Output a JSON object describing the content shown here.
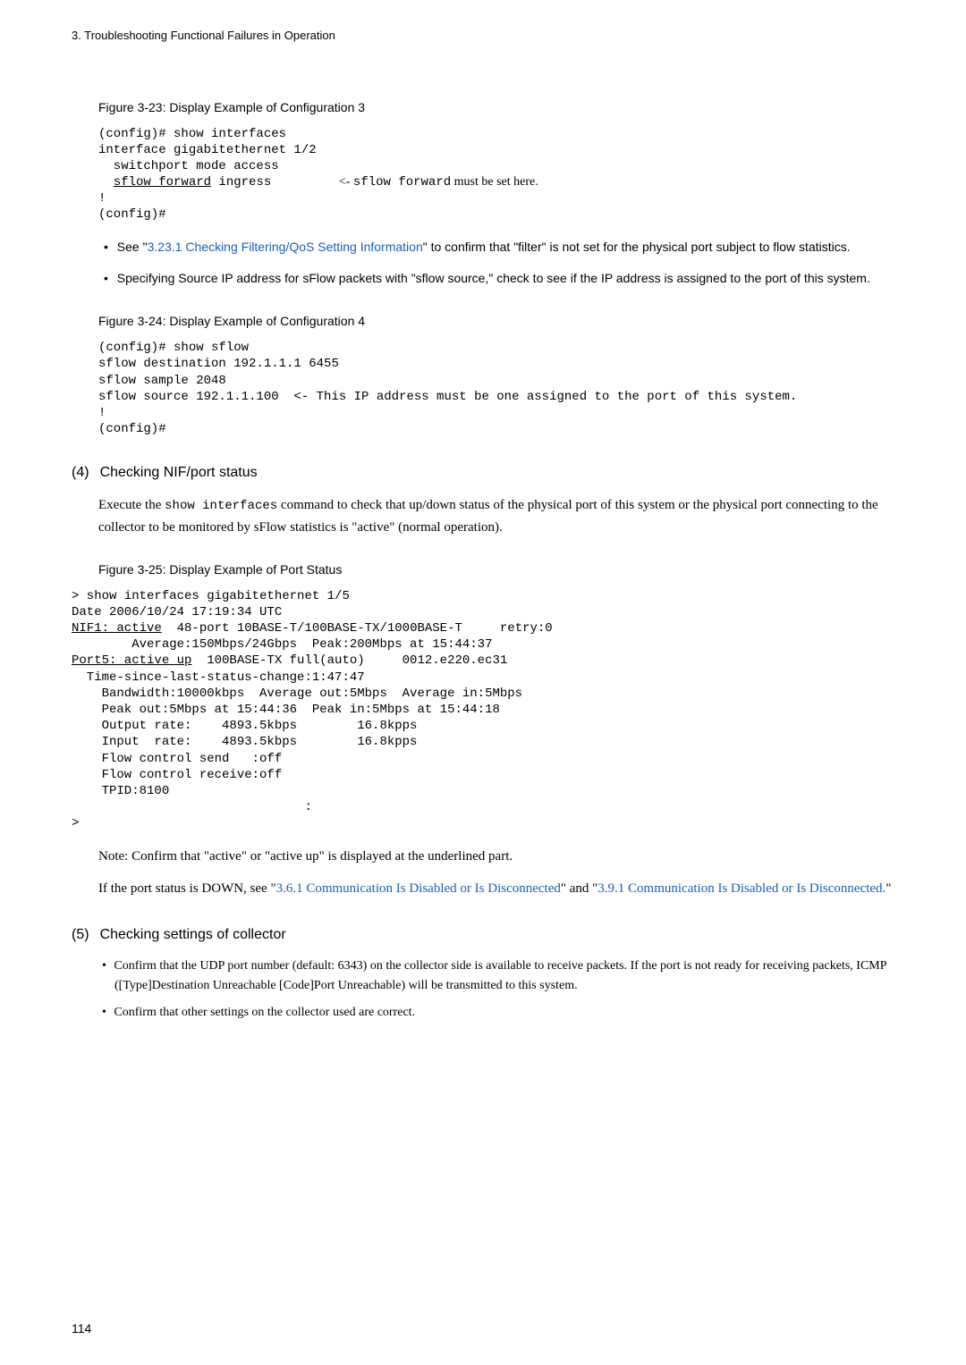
{
  "header": {
    "chapter_number": "3.",
    "chapter_title": "Troubleshooting Functional Failures in Operation"
  },
  "fig323": {
    "title": "Figure 3-23: Display Example of Configuration 3",
    "line1": "(config)# show interfaces",
    "line2": "interface gigabitethernet 1/2",
    "line3": "  switchport mode access",
    "line4a": "  ",
    "line4b": "sflow forward",
    "line4c": " ingress         ",
    "line4d": "<- ",
    "line4e": "sflow forward",
    "line4f": " must be set here.",
    "line5": "!",
    "line6": "(config)#"
  },
  "bullets1": {
    "b1_prefix": "See \"",
    "b1_link": "3.23.1 Checking Filtering/QoS Setting Information",
    "b1_suffix": "\" to confirm that \"filter\" is not set for the physical port subject to flow statistics.",
    "b2": "Specifying Source IP address for sFlow packets with \"sflow source,\" check to see if the IP address is assigned to the port of this system."
  },
  "fig324": {
    "title": "Figure 3-24: Display Example of Configuration 4",
    "line1": "(config)# show sflow",
    "line2": "sflow destination 192.1.1.1 6455",
    "line3": "sflow sample 2048",
    "line4": "sflow source 192.1.1.100  <- This IP address must be one assigned to the port of this system.",
    "line5": "!",
    "line6": "(config)#"
  },
  "section4": {
    "prefix": "(4)",
    "title": "Checking NIF/port status",
    "body_part1": "Execute the ",
    "body_cmd": "show interfaces",
    "body_part2": " command to check that up/down status of the physical port of this system or the physical port connecting to the collector to be monitored by sFlow statistics is \"active\" (normal operation)."
  },
  "fig325": {
    "title": "Figure 3-25: Display Example of Port Status",
    "l1": "> show interfaces gigabitethernet 1/5",
    "l2": "Date 2006/10/24 17:19:34 UTC",
    "l3a": "NIF1: active",
    "l3b": "  48-port 10BASE-T/100BASE-TX/1000BASE-T     retry:0",
    "l4": "        Average:150Mbps/24Gbps  Peak:200Mbps at 15:44:37",
    "l5a": "Port5: active up",
    "l5b": "  100BASE-TX full(auto)     0012.e220.ec31",
    "l6": "  Time-since-last-status-change:1:47:47",
    "l7": "    Bandwidth:10000kbps  Average out:5Mbps  Average in:5Mbps",
    "l8": "    Peak out:5Mbps at 15:44:36  Peak in:5Mbps at 15:44:18",
    "l9": "    Output rate:    4893.5kbps        16.8kpps",
    "l10": "    Input  rate:    4893.5kbps        16.8kpps",
    "l11": "    Flow control send   :off",
    "l12": "    Flow control receive:off",
    "l13": "    TPID:8100",
    "l14": "                               :",
    "l15": ">"
  },
  "note1": "Note: Confirm that \"active\" or \"active up\" is displayed at the underlined part.",
  "note2": {
    "p1": "If the port status is DOWN, see \"",
    "link1": "3.6.1 Communication Is Disabled or Is Disconnected",
    "mid": "\" and \"",
    "link2": "3.9.1 Communication Is Disabled or Is Disconnected.",
    "suffix": "\""
  },
  "section5": {
    "prefix": "(5)",
    "title": "Checking settings of collector",
    "bullet1": "Confirm that the UDP port number (default: 6343) on the collector side is available to receive packets. If the port is not ready for receiving packets, ICMP ([Type]Destination Unreachable [Code]Port Unreachable) will be transmitted to this system.",
    "bullet2": "Confirm that other settings on the collector used are correct."
  },
  "page_number": "114"
}
